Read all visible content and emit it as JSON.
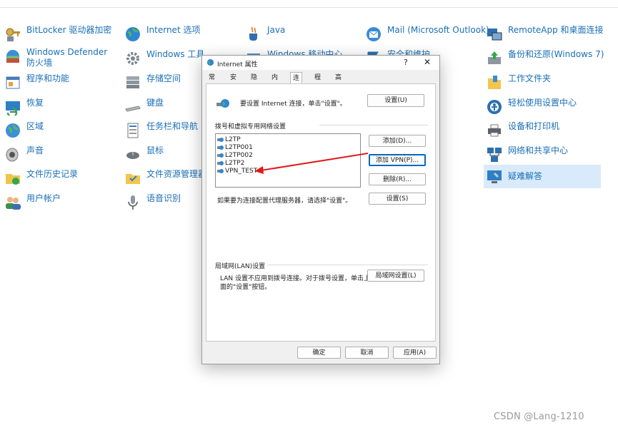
{
  "control_panel": {
    "items": [
      {
        "label": "BitLocker 驱动器加密",
        "icon": "bitlocker-key-icon"
      },
      {
        "label": "Windows Defender 防火墙",
        "icon": "firewall-icon"
      },
      {
        "label": "程序和功能",
        "icon": "programs-icon"
      },
      {
        "label": "恢复",
        "icon": "recovery-icon"
      },
      {
        "label": "区域",
        "icon": "region-globe-icon"
      },
      {
        "label": "声音",
        "icon": "speaker-icon"
      },
      {
        "label": "文件历史记录",
        "icon": "file-history-icon"
      },
      {
        "label": "用户帐户",
        "icon": "users-icon"
      },
      {
        "label": "Internet 选项",
        "icon": "internet-globe-icon"
      },
      {
        "label": "Windows 工具",
        "icon": "gear-icon"
      },
      {
        "label": "存储空间",
        "icon": "storage-icon"
      },
      {
        "label": "键盘",
        "icon": "keyboard-icon"
      },
      {
        "label": "任务栏和导航",
        "icon": "taskbar-icon"
      },
      {
        "label": "鼠标",
        "icon": "mouse-icon"
      },
      {
        "label": "文件资源管理器",
        "icon": "folder-icon"
      },
      {
        "label": "语音识别",
        "icon": "microphone-icon"
      },
      {
        "label": "Java",
        "icon": "java-cup-icon"
      },
      {
        "label": "Windows 移动中心",
        "icon": "mobility-icon"
      },
      {
        "label": "Mail (Microsoft Outlook)",
        "icon": "mail-icon"
      },
      {
        "label": "安全和维护",
        "icon": "flag-icon"
      },
      {
        "label": "RemoteApp 和桌面连接",
        "icon": "remoteapp-icon"
      },
      {
        "label": "备份和还原(Windows 7)",
        "icon": "backup-icon"
      },
      {
        "label": "工作文件夹",
        "icon": "work-folders-icon"
      },
      {
        "label": "轻松使用设置中心",
        "icon": "ease-of-access-icon"
      },
      {
        "label": "设备和打印机",
        "icon": "printer-icon"
      },
      {
        "label": "网络和共享中心",
        "icon": "network-icon"
      },
      {
        "label": "疑难解答",
        "icon": "troubleshoot-icon"
      }
    ]
  },
  "dialog": {
    "title": "Internet 属性",
    "help": "?",
    "close": "✕",
    "tabs": [
      "常规",
      "安全",
      "隐私",
      "内容",
      "连接",
      "程序",
      "高级"
    ],
    "setup_text": "要设置 Internet 连接，单击\"设置\"。",
    "setup_button": "设置(U)",
    "dialup_title": "拨号和虚拟专用网络设置",
    "connections": [
      "L2TP",
      "L2TP001",
      "L2TP002",
      "L2TP2",
      "VPN_TEST"
    ],
    "add_button": "添加(D)...",
    "add_vpn_button": "添加 VPN(P)...",
    "remove_button": "删除(R)...",
    "proxy_text": "如果要为连接配置代理服务器，请选择\"设置\"。",
    "settings_button": "设置(S)",
    "lan_title": "局域网(LAN)设置",
    "lan_text_1": "LAN 设置不应用到拨号连接。对于拨号设置，单击上",
    "lan_text_2": "面的\"设置\"按钮。",
    "lan_button": "局域网设置(L)",
    "ok_button": "确定",
    "cancel_button": "取消",
    "apply_button": "应用(A)"
  },
  "watermark": "CSDN @Lang-1210",
  "colors": {
    "link": "#1a6fb7",
    "highlight": "#d9eafb",
    "arrow": "#e0191b",
    "focus": "#0067c0"
  }
}
